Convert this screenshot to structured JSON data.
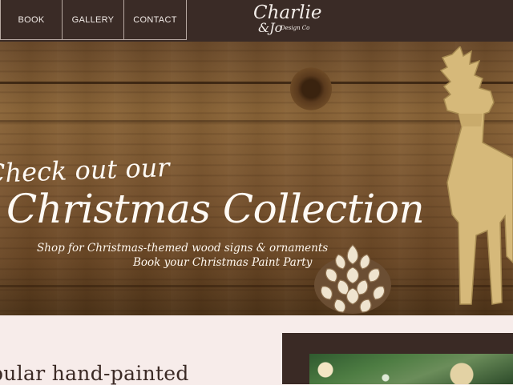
{
  "nav": {
    "items": [
      {
        "label": "BOOK"
      },
      {
        "label": "GALLERY"
      },
      {
        "label": "CONTACT"
      }
    ],
    "logo": {
      "main": "Charlie",
      "amp": "&Jo",
      "sub": "Design Co"
    }
  },
  "hero": {
    "line1": "Check out our",
    "line2": "Christmas Collection",
    "sub1": "Shop for Christmas-themed wood signs & ornaments",
    "sub2": "Book your Christmas Paint Party"
  },
  "section": {
    "heading": "pular hand-painted"
  },
  "colors": {
    "nav_bg": "#3a2b26",
    "page_bg": "#f7ecea",
    "wood": "#7a5530",
    "text_light": "#fffaf4"
  },
  "icons": {
    "decor1": "reindeer",
    "decor2": "pinecone"
  }
}
